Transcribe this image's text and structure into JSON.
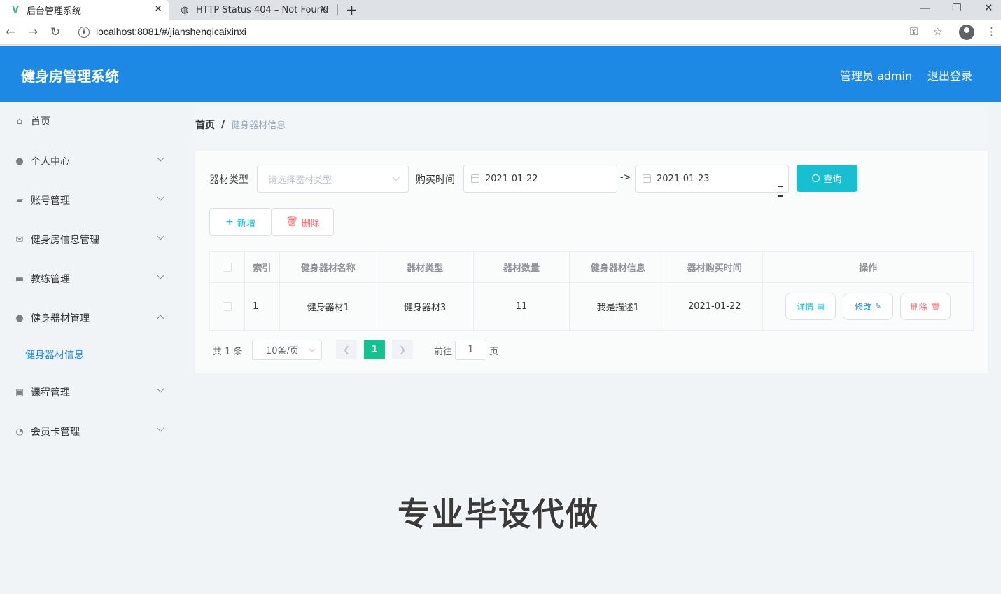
{
  "browser": {
    "tabs": [
      {
        "title": "后台管理系统",
        "active": true
      },
      {
        "title": "HTTP Status 404 – Not Found",
        "active": false
      }
    ],
    "url": "localhost:8081/#/jianshenqicaixinxi"
  },
  "header": {
    "title": "健身房管理系统",
    "user": "管理员 admin",
    "logout": "退出登录",
    "color": "#1e88e5"
  },
  "sidebar": {
    "items": [
      {
        "label": "首页",
        "icon": "home-icon"
      },
      {
        "label": "个人中心",
        "icon": "user-icon"
      },
      {
        "label": "账号管理",
        "icon": "account-icon"
      },
      {
        "label": "健身房信息管理",
        "icon": "mail-icon"
      },
      {
        "label": "教练管理",
        "icon": "briefcase-icon"
      },
      {
        "label": "健身器材管理",
        "icon": "user-icon",
        "expanded": true
      },
      {
        "label": "课程管理",
        "icon": "clipboard-icon"
      },
      {
        "label": "会员卡管理",
        "icon": "gauge-icon"
      }
    ],
    "sub_item": "健身器材信息"
  },
  "breadcrumb": {
    "home": "首页",
    "sep": "/",
    "current": "健身器材信息"
  },
  "filters": {
    "type_label": "器材类型",
    "type_placeholder": "请选择器材类型",
    "time_label": "购买时间",
    "date_start": "2021-01-22",
    "date_sep": "->",
    "date_end": "2021-01-23",
    "query": "查询"
  },
  "actions": {
    "add": "新增",
    "delete": "删除"
  },
  "table": {
    "columns": [
      "索引",
      "健身器材名称",
      "器材类型",
      "器材数量",
      "健身器材信息",
      "器材购买时间",
      "操作"
    ],
    "rows": [
      {
        "index": "1",
        "name": "健身器材1",
        "type": "健身器材3",
        "count": "11",
        "info": "我是描述1",
        "date": "2021-01-22"
      }
    ],
    "op_detail": "详情",
    "op_edit": "修改",
    "op_delete": "删除"
  },
  "pagination": {
    "total": "共 1 条",
    "page_size": "10条/页",
    "current": "1",
    "goto": "前往",
    "goto_value": "1",
    "page_suffix": "页"
  },
  "watermark": "专业毕设代做",
  "accent": "#17bfd1"
}
